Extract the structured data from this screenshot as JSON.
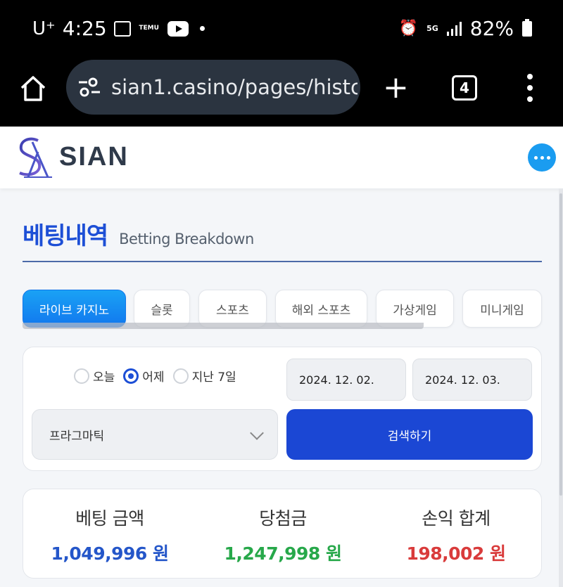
{
  "status_bar": {
    "carrier": "U⁺",
    "time": "4:25",
    "temu_label": "TEMU",
    "network": "5G",
    "battery": "82%"
  },
  "browser": {
    "url": "sian1.casino/pages/histc",
    "tab_count": "4"
  },
  "site": {
    "logo_text": "SIAN"
  },
  "page": {
    "title_ko": "베팅내역",
    "title_en": "Betting Breakdown"
  },
  "tabs": [
    {
      "label": "라이브 카지노",
      "active": true
    },
    {
      "label": "슬롯"
    },
    {
      "label": "스포츠"
    },
    {
      "label": "해외 스포츠"
    },
    {
      "label": "가상게임"
    },
    {
      "label": "미니게임"
    }
  ],
  "filter": {
    "radios": [
      {
        "label": "오늘",
        "checked": false
      },
      {
        "label": "어제",
        "checked": true
      },
      {
        "label": "지난 7일",
        "checked": false
      }
    ],
    "date_from": "2024. 12. 02.",
    "date_to": "2024. 12. 03.",
    "provider": "프라그마틱",
    "search_label": "검색하기"
  },
  "summary": {
    "bet_label": "베팅 금액",
    "bet_value": "1,049,996 원",
    "win_label": "당첨금",
    "win_value": "1,247,998 원",
    "profit_label": "손익 합계",
    "profit_value": "198,002 원"
  },
  "colors": {
    "accent_blue": "#1d4fd6",
    "bet_value": "#2456c9",
    "win_value": "#27a84a",
    "profit_value": "#d93b3b"
  }
}
